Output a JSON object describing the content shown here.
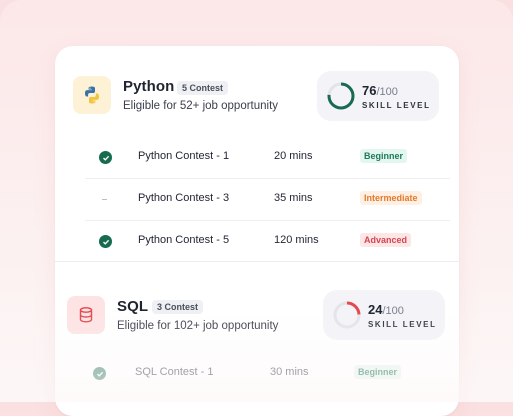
{
  "python": {
    "name": "Python",
    "badge": "5 Contest",
    "eligible": "Eligible for 52+ job opportunity",
    "score": "76",
    "score_max": "/100",
    "score_fraction": 0.76,
    "skill_label": "SKILL LEVEL",
    "ring_color": "#176b4f",
    "rows": [
      {
        "title": "Python Contest - 1",
        "time": "20 mins",
        "level": "Beginner",
        "status": "completed"
      },
      {
        "title": "Python Contest - 3",
        "time": "35 mins",
        "level": "Intermediate",
        "status": "pending"
      },
      {
        "title": "Python Contest - 5",
        "time": "120 mins",
        "level": "Advanced",
        "status": "completed"
      }
    ]
  },
  "sql": {
    "name": "SQL",
    "badge": "3 Contest",
    "eligible": "Eligible for 102+ job opportunity",
    "score": "24",
    "score_max": "/100",
    "score_fraction": 0.24,
    "skill_label": "SKILL LEVEL",
    "ring_color": "#e5484d",
    "rows": [
      {
        "title": "SQL Contest - 1",
        "time": "30 mins",
        "level": "Beginner",
        "status": "completed"
      }
    ]
  },
  "icons": {
    "python": "python-logo-icon",
    "sql": "database-icon",
    "check": "check-circle-icon"
  },
  "colors": {
    "beginner": "#1f7a5a",
    "intermediate": "#e07b2d",
    "advanced": "#d6454f"
  }
}
